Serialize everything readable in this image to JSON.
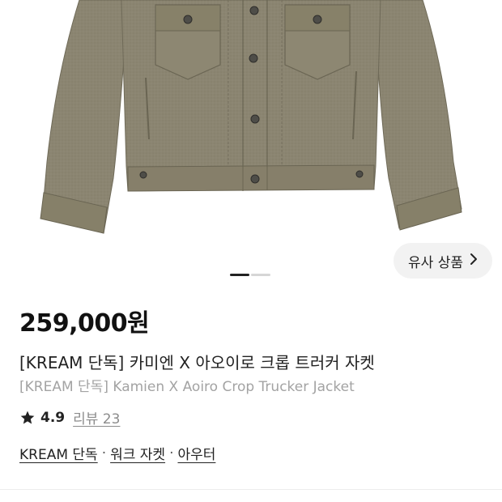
{
  "product": {
    "price": "259,000원",
    "title_ko": "[KREAM 단독] 카미엔 X 아오이로 크롭 트러커 자켓",
    "title_en": "[KREAM 단독] Kamien X Aoiro Crop Trucker Jacket",
    "rating": "4.9",
    "review_label": "리뷰 23"
  },
  "similar_button": {
    "label": "유사 상품",
    "icon": "chevron-right-icon"
  },
  "tags": {
    "items": [
      "KREAM 단독",
      "워크 자켓",
      "아우터"
    ],
    "separator": "·"
  },
  "carousel": {
    "current": 1,
    "total": 2
  },
  "colors": {
    "jacket": "#8a8470",
    "jacket_dark": "#6f6a58",
    "accent_star": "#222222"
  }
}
